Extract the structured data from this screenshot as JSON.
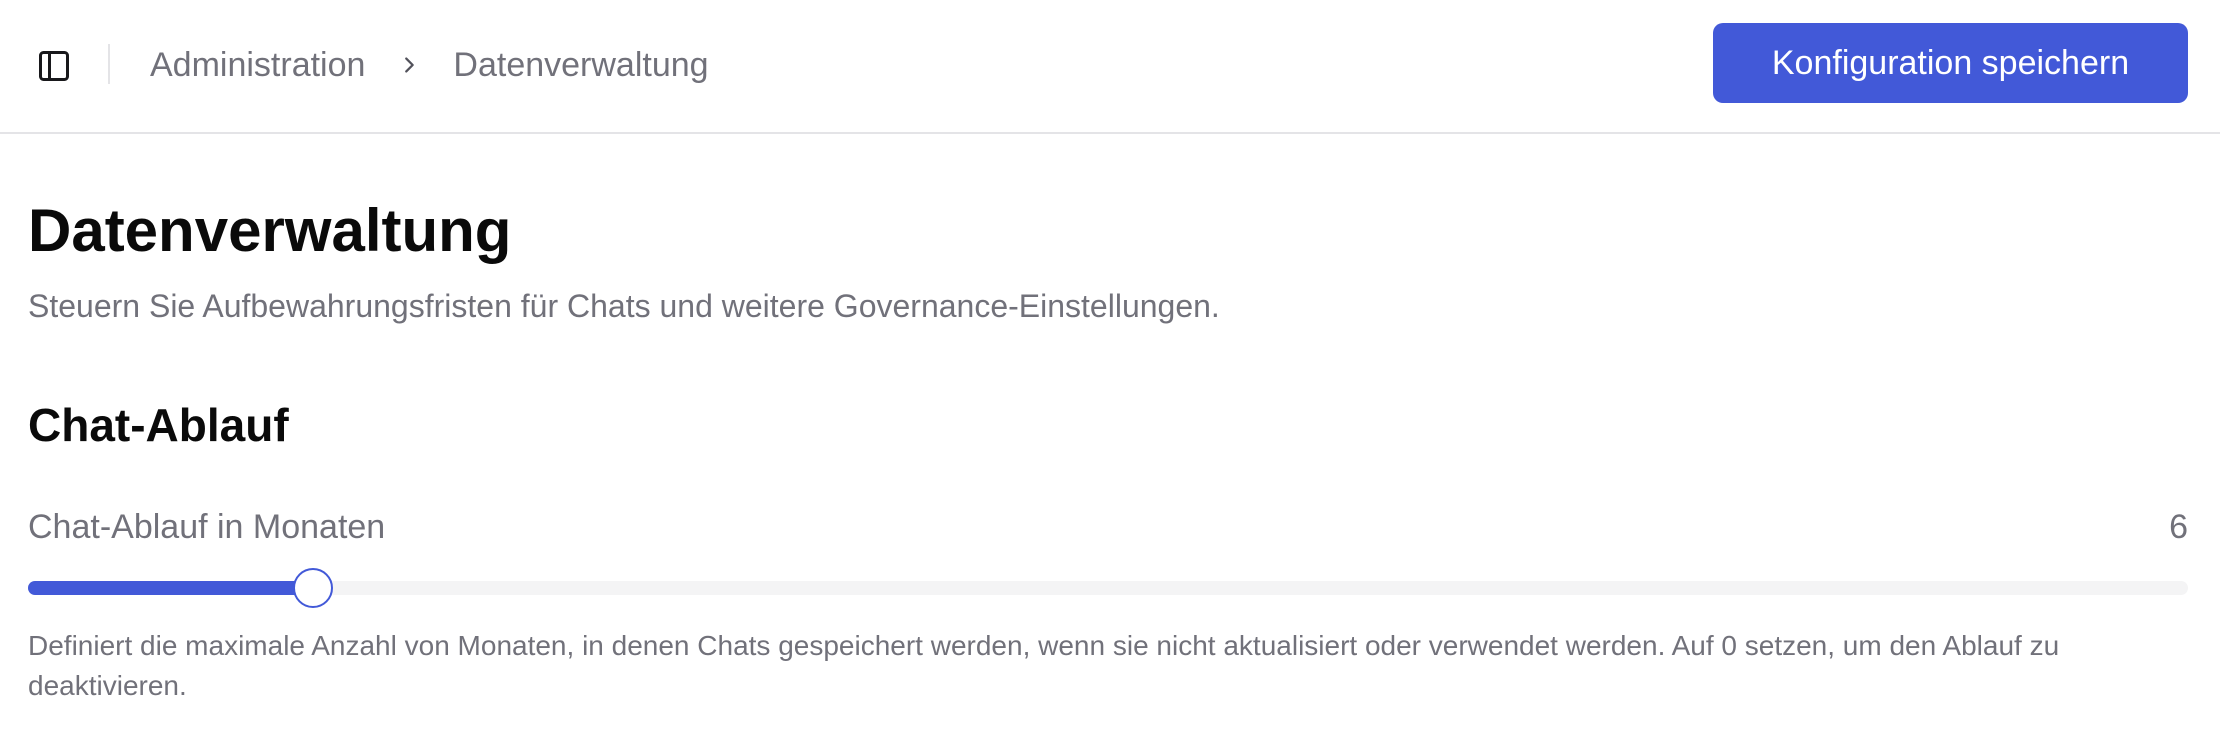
{
  "header": {
    "sidebar_toggle_icon": "sidebar-panel-icon",
    "breadcrumb": {
      "items": [
        "Administration",
        "Datenverwaltung"
      ],
      "separator_icon": "chevron-right-icon"
    },
    "save_button_label": "Konfiguration speichern"
  },
  "page": {
    "title": "Datenverwaltung",
    "subtitle": "Steuern Sie Aufbewahrungsfristen für Chats und weitere Governance-Einstellungen."
  },
  "section": {
    "title": "Chat-Ablauf",
    "field": {
      "label": "Chat-Ablauf in Monaten",
      "value": "6",
      "slider_fraction": 0.132,
      "help": "Definiert die maximale Anzahl von Monaten, in denen Chats gespeichert werden, wenn sie nicht aktualisiert oder verwendet werden. Auf 0 setzen, um den Ablauf zu deaktivieren."
    }
  },
  "colors": {
    "accent": "#4259d8",
    "muted_text": "#71717a",
    "border": "#e4e4e7",
    "track": "#f4f4f5"
  }
}
